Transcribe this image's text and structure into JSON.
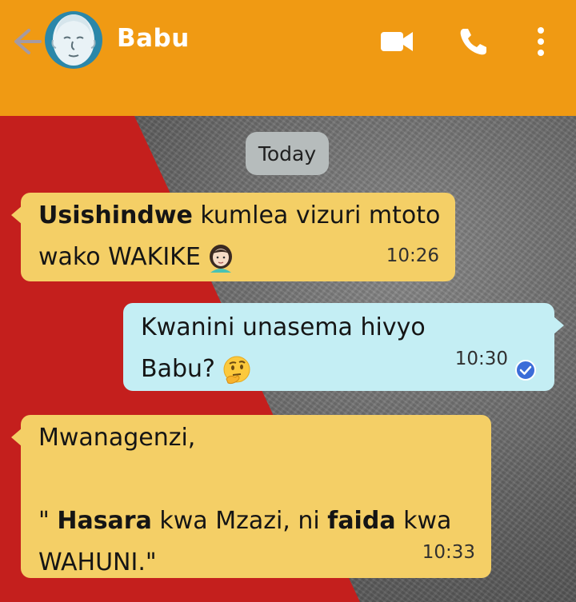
{
  "header": {
    "contact_name": "Babu",
    "icons": [
      "back-arrow-icon",
      "video-call-icon",
      "phone-icon",
      "more-options-icon"
    ],
    "background_color": "#f09a13"
  },
  "chat": {
    "date_label": "Today",
    "messages": [
      {
        "direction": "incoming",
        "line1_bold": "Usishindwe",
        "line1_rest": " kumlea vizuri mtoto",
        "line2": "wako WAKIKE",
        "emoji": "woman-emoji",
        "time": "10:26"
      },
      {
        "direction": "outgoing",
        "line1": "Kwanini unasema hivyo",
        "line2": "Babu?",
        "emoji": "thinking-face-emoji",
        "time": "10:30",
        "status": "read-check-icon"
      },
      {
        "direction": "incoming",
        "line1": "Mwanagenzi,",
        "line3_pre": "\" ",
        "line3_bold1": "Hasara",
        "line3_mid": " kwa Mzazi, ni ",
        "line3_bold2": "faida",
        "line3_post": " kwa",
        "line4": "WAHUNI.\"",
        "time": "10:33"
      }
    ],
    "colors": {
      "incoming_bubble": "#f4cf66",
      "outgoing_bubble": "#c4eef4",
      "date_pill": "#b6bcbc"
    }
  }
}
